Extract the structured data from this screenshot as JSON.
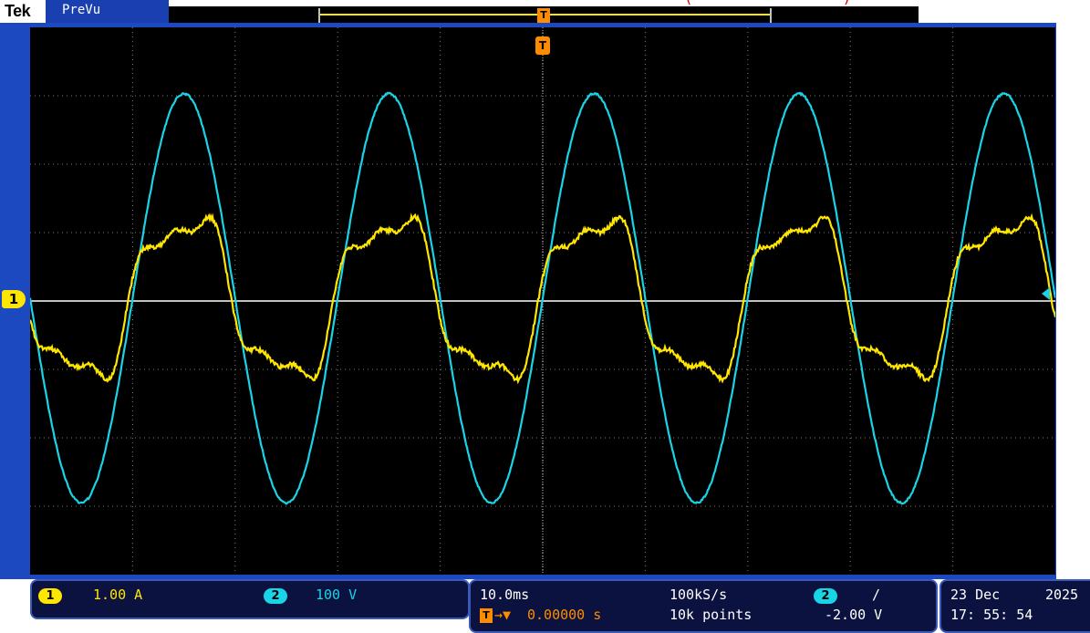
{
  "header": {
    "brand": "Tek",
    "mode": "PreVu",
    "red_label": "(",
    "red_label_close": ")"
  },
  "channels": {
    "ch1": {
      "number": "1",
      "scale": "1.00 A",
      "color": "#ffe600"
    },
    "ch2": {
      "number": "2",
      "scale": "100 V",
      "color": "#19d4e6"
    }
  },
  "trigger_marker": "T",
  "timebase": {
    "horizontal_scale": "10.0ms",
    "sample_rate": "100kS/s",
    "record_length": "10k points",
    "trigger_position": "0.00000 s",
    "trigger_source": "2",
    "trigger_slope": "/",
    "trigger_level": "-2.00 V"
  },
  "datetime": {
    "date": "23 Dec",
    "year": "2025",
    "time": "17: 55: 54"
  },
  "chart_data": {
    "type": "line",
    "xlabel": "",
    "ylabel": "",
    "x_divisions": 10,
    "y_divisions": 8,
    "series": [
      {
        "name": "1",
        "color": "#19d4e6",
        "kind": "voltage_sine",
        "cycles": 5,
        "amplitude_div": 3.0
      },
      {
        "name": "2",
        "color": "#ffe600",
        "kind": "current",
        "cycles": 5,
        "amplitude_div": 1.6
      }
    ]
  }
}
